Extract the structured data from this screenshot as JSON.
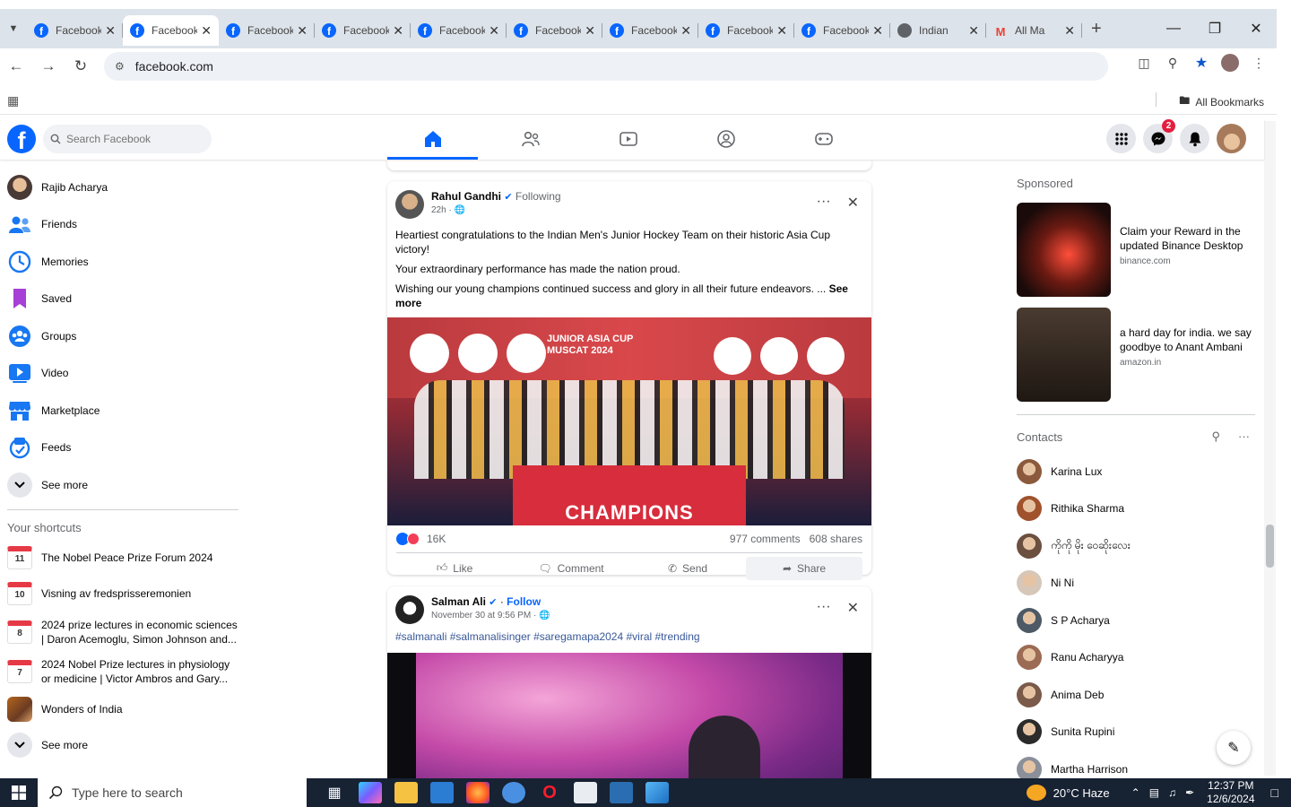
{
  "browser": {
    "tabs": [
      {
        "title": "Facebook",
        "icon": "facebook-icon",
        "active": false
      },
      {
        "title": "Facebook",
        "icon": "facebook-icon",
        "active": true
      },
      {
        "title": "Facebook",
        "icon": "facebook-icon",
        "active": false
      },
      {
        "title": "Facebook",
        "icon": "facebook-icon",
        "active": false
      },
      {
        "title": "Facebook",
        "icon": "facebook-icon",
        "active": false
      },
      {
        "title": "Facebook",
        "icon": "facebook-icon",
        "active": false
      },
      {
        "title": "Facebook",
        "icon": "facebook-icon",
        "active": false
      },
      {
        "title": "Facebook",
        "icon": "facebook-icon",
        "active": false
      },
      {
        "title": "Facebook",
        "icon": "facebook-icon",
        "active": false
      },
      {
        "title": "Indian",
        "icon": "globe-icon",
        "active": false
      },
      {
        "title": "All Ma",
        "icon": "gmail-icon",
        "active": false
      }
    ],
    "url": "facebook.com",
    "all_bookmarks": "All Bookmarks",
    "brand_color": "#0866ff"
  },
  "facebook": {
    "search_placeholder": "Search Facebook",
    "messenger_badge": "2"
  },
  "left_nav": {
    "profile_name": "Rajib Acharya",
    "items": [
      "Friends",
      "Memories",
      "Saved",
      "Groups",
      "Video",
      "Marketplace",
      "Feeds",
      "See more"
    ],
    "shortcuts_heading": "Your shortcuts",
    "shortcuts": [
      {
        "day": "11",
        "label": "The Nobel Peace Prize Forum 2024"
      },
      {
        "day": "10",
        "label": "Visning av fredsprisseremonien"
      },
      {
        "day": "8",
        "label": "2024 prize lectures in economic sciences | Daron Acemoglu, Simon Johnson and..."
      },
      {
        "day": "7",
        "label": "2024 Nobel Prize lectures in physiology or medicine | Victor Ambros and Gary..."
      },
      {
        "day": "",
        "label": "Wonders of India"
      }
    ],
    "shortcuts_see_more": "See more"
  },
  "prev_post_actions": [
    "Like",
    "Comment",
    "Send",
    "Share"
  ],
  "post1": {
    "author": "Rahul Gandhi",
    "relation": "Following",
    "time": "22h",
    "text1": "Heartiest congratulations to the Indian Men's Junior Hockey Team on their historic Asia Cup victory!",
    "text2": "Your extraordinary performance has made the nation proud.",
    "text3": "Wishing our young champions continued success and glory in all their future endeavors. ...",
    "see_more": "See more",
    "image_banner": "CHAMPIONS",
    "image_header": "JUNIOR ASIA CUP MUSCAT 2024",
    "reactions": "16K",
    "comments": "977 comments",
    "shares": "608 shares",
    "actions": [
      "Like",
      "Comment",
      "Send",
      "Share"
    ]
  },
  "post2": {
    "author": "Salman Ali",
    "relation": "Follow",
    "time": "November 30 at 9:56 PM",
    "hashtags": "#salmanali #salmanalisinger #saregamapa2024 #viral #trending"
  },
  "sponsored": {
    "heading": "Sponsored",
    "ads": [
      {
        "text": "Claim your Reward in the updated Binance Desktop",
        "domain": "binance.com"
      },
      {
        "text": "a hard day for india. we say goodbye to Anant Ambani",
        "domain": "amazon.in"
      }
    ]
  },
  "contacts": {
    "heading": "Contacts",
    "list": [
      "Karina Lux",
      "Rithika Sharma",
      "ကိုကို မိုး ဝေဆိုးလေး",
      "Ni Ni",
      "S P Acharya",
      "Ranu Acharyya",
      "Anima Deb",
      "Sunita Rupini",
      "Martha Harrison"
    ]
  },
  "taskbar": {
    "search_placeholder": "Type here to search",
    "weather": "20°C  Haze",
    "time": "12:37 PM",
    "date": "12/6/2024"
  }
}
